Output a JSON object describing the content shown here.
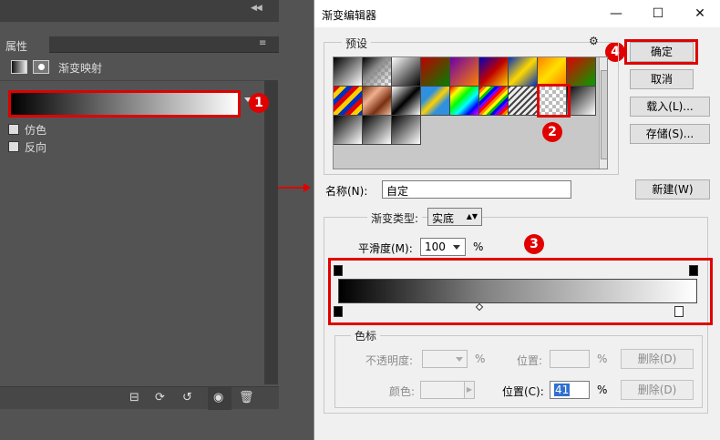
{
  "photoshop": {
    "panel_tab": "属性",
    "adjustment_title": "渐变映射",
    "dither_label": "仿色",
    "reverse_label": "反向"
  },
  "dialog": {
    "title": "渐变编辑器",
    "ok": "确定",
    "cancel": "取消",
    "load": "载入(L)...",
    "save": "存储(S)...",
    "presets_label": "预设",
    "name_label": "名称(N):",
    "name_value": "自定",
    "new_button": "新建(W)",
    "gradient_type_label": "渐变类型:",
    "gradient_type_value": "实底",
    "smoothness_label": "平滑度(M):",
    "smoothness_value": "100",
    "smoothness_unit": "%",
    "color_stops_label": "色标",
    "opacity_label": "不透明度:",
    "percent": "%",
    "location_label": "位置:",
    "delete_label": "删除(D)",
    "color_label": "颜色:",
    "location_c_label": "位置(C):",
    "location_c_value": "41"
  },
  "callouts": [
    "1",
    "2",
    "3",
    "4"
  ],
  "colors": {
    "highlight": "#e00000"
  }
}
